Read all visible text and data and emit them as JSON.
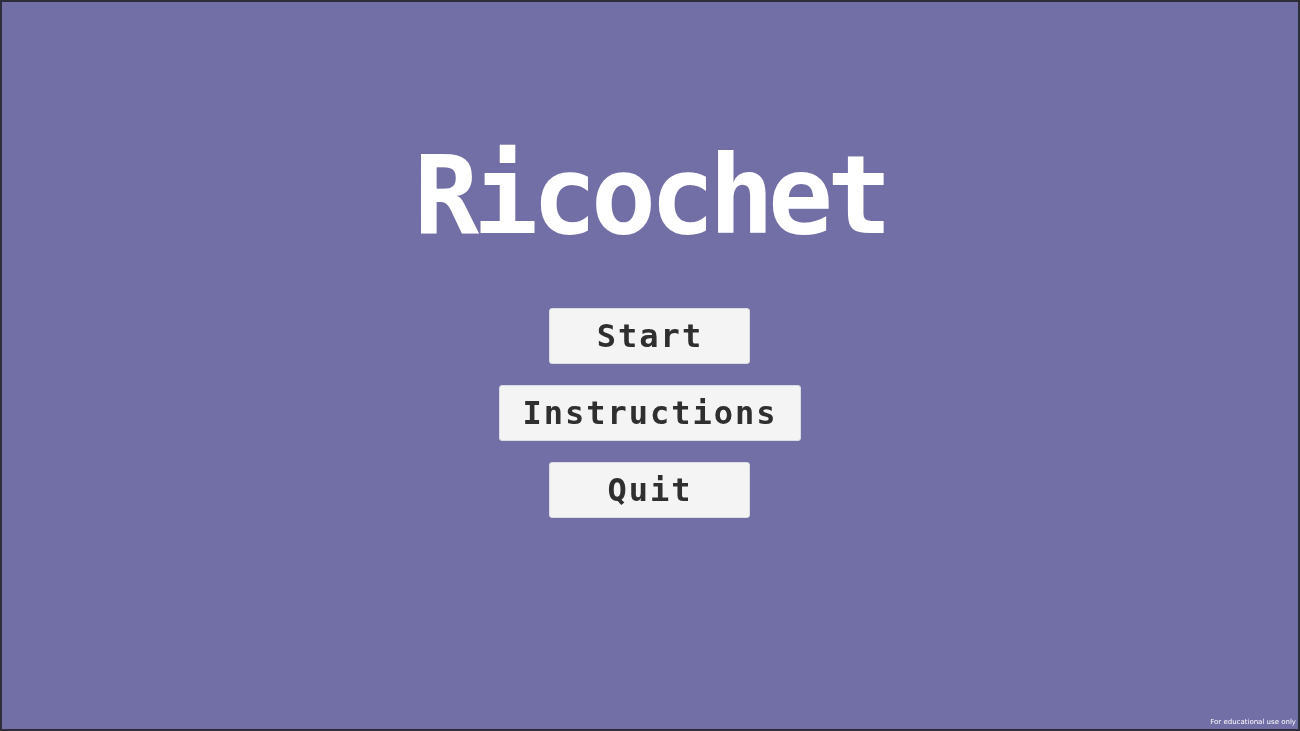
{
  "title": "Ricochet",
  "menu": [
    {
      "label": "Start"
    },
    {
      "label": "Instructions"
    },
    {
      "label": "Quit"
    }
  ],
  "footer_note": "For educational use only"
}
